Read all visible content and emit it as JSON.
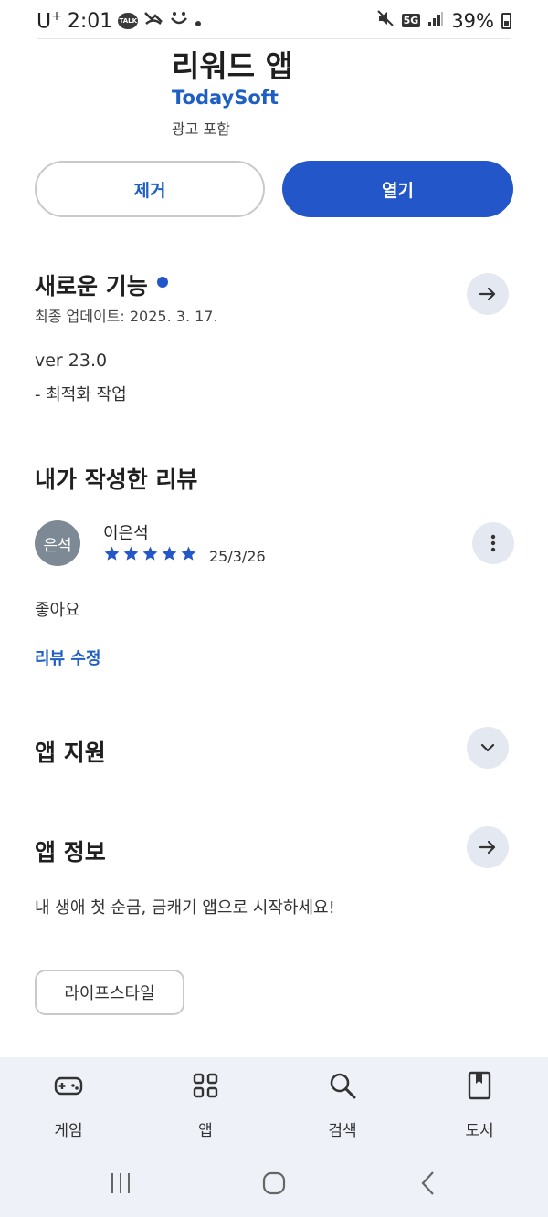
{
  "status_bar": {
    "carrier": "U",
    "carrier_sup": "+",
    "time": "2:01",
    "talk_badge": "TALK",
    "network": "5G",
    "battery": "39%"
  },
  "app": {
    "title": "리워드 앱",
    "developer": "TodaySoft",
    "ad_note": "광고 포함"
  },
  "actions": {
    "remove_label": "제거",
    "open_label": "열기"
  },
  "whats_new": {
    "title": "새로운 기능",
    "updated": "최종 업데이트: 2025. 3. 17.",
    "version": "ver 23.0",
    "note": "- 최적화 작업"
  },
  "my_review": {
    "title": "내가 작성한 리뷰",
    "avatar_text": "은석",
    "reviewer": "이은석",
    "rating": 5,
    "date": "25/3/26",
    "text": "좋아요",
    "edit_label": "리뷰 수정"
  },
  "app_support": {
    "title": "앱 지원"
  },
  "app_info": {
    "title": "앱 정보",
    "description": "내 생애 첫 순금, 금캐기 앱으로 시작하세요!",
    "category": "라이프스타일"
  },
  "bottom_nav": {
    "items": [
      {
        "label": "게임",
        "icon": "gamepad-icon"
      },
      {
        "label": "앱",
        "icon": "apps-grid-icon"
      },
      {
        "label": "검색",
        "icon": "search-icon"
      },
      {
        "label": "도서",
        "icon": "book-icon"
      }
    ]
  },
  "colors": {
    "accent": "#2357c9",
    "link": "#1f5fc4",
    "nav_bg": "#eef2f8"
  }
}
